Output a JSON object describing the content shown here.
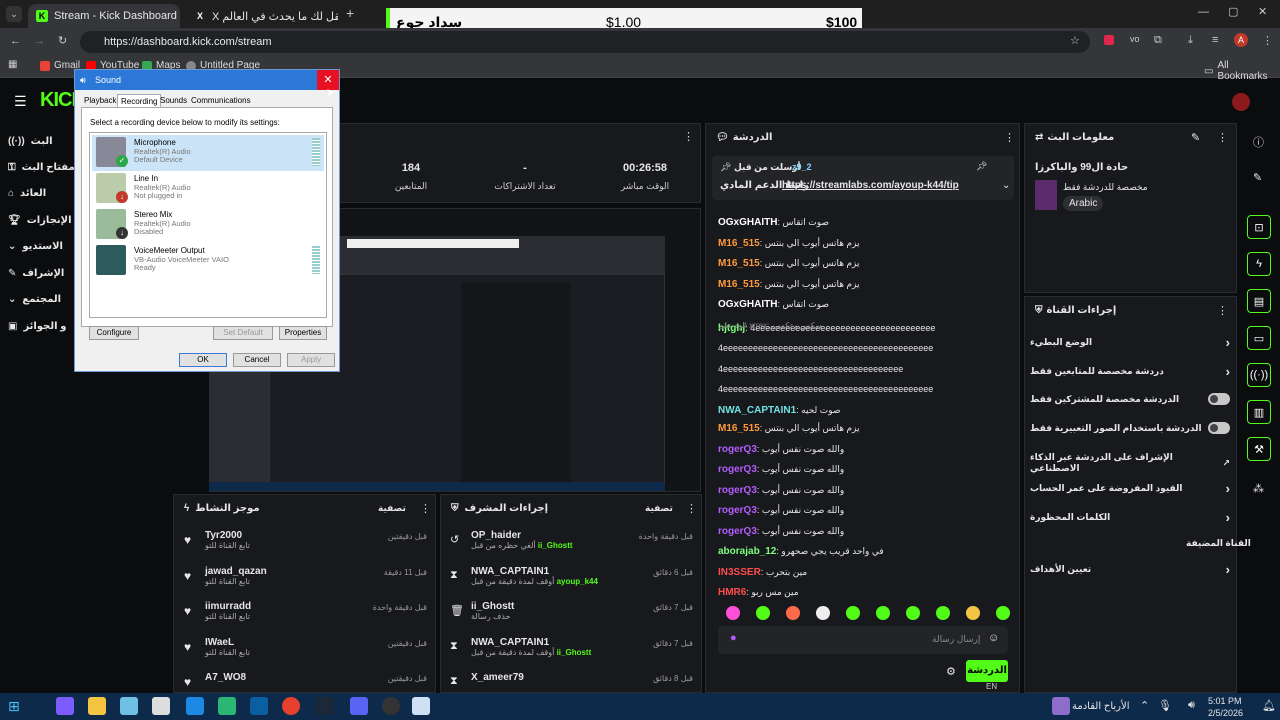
{
  "browser": {
    "tabs": [
      {
        "label": "Stream - Kick Dashboard"
      },
      {
        "label": "X يتقل لك ما يحدث في العالم / X"
      }
    ],
    "url": "https://dashboard.kick.com/stream",
    "bookmarks": [
      {
        "label": "Gmail"
      },
      {
        "label": "YouTube"
      },
      {
        "label": "Maps"
      },
      {
        "label": "Untitled Page"
      }
    ],
    "all_bookmarks": "All Bookmarks"
  },
  "donation_bar": {
    "title": "سداد جوع",
    "current": "$1.00",
    "goal": "$100"
  },
  "leftnav": {
    "items": [
      {
        "label": "البث"
      },
      {
        "label": "مفتاح البث"
      },
      {
        "label": "العائد"
      },
      {
        "label": "الإنجازات"
      },
      {
        "label": "الاستديو"
      },
      {
        "label": "الإشراف"
      },
      {
        "label": "المجتمع"
      },
      {
        "label": "و الجوائز"
      }
    ]
  },
  "stats": [
    {
      "value": "00:26:58",
      "label": "الوقت مباشر"
    },
    {
      "value": "-",
      "label": "تعداد الاشتراكات"
    },
    {
      "value": "184",
      "label": "المتابعين"
    }
  ],
  "chat": {
    "title": "الدردشة",
    "pinned_user": "z9_2",
    "pinned_by": "أرسلت من قبل",
    "pinned_text": "رابط الدعم المادي",
    "pinned_link": "https://streamlabs.com/ayoup-k44/tip",
    "messages": [
      {
        "user": "OGxGHAITH",
        "text": "صوت اتقاس",
        "color": "#ffffff"
      },
      {
        "user": "M16_515",
        "text": "يزم هاتس أيوب الي بنتس",
        "color": "#ff9a3c"
      },
      {
        "user": "M16_515",
        "text": "يزم هاتس أيوب الي بنتس",
        "color": "#ff9a3c"
      },
      {
        "user": "M16_515",
        "text": "يزم هاتس أيوب الي بنتس",
        "color": "#ff9a3c"
      },
      {
        "user": "OGxGHAITH",
        "text": "صوت اتقاس",
        "color": "#ffffff"
      },
      {
        "user": "hjtghj",
        "text": "4eeeeeeeeeeeeeeeeeeeeeeeeeeeeeeeeeeee",
        "color": "#7cff7c"
      },
      {
        "user": "",
        "text": "4eeeeeeeeeeeeeeeeeeeeeeeeeeeeeeeeeeeeeeeeee",
        "color": "#ffffff"
      },
      {
        "user": "",
        "text": "4eeeeeeeeeeeeeeeeeeeeeeeeeeeeeeeeeeee",
        "color": "#ffffff"
      },
      {
        "user": "",
        "text": "4eeeeeeeeeeeeeeeeeeeeeeeeeeeeeeeeeeeeeeeeee",
        "color": "#ffffff"
      },
      {
        "user": "NWA_CAPTAIN1",
        "text": "صوت لحيه",
        "color": "#6fe3e3"
      },
      {
        "user": "M16_515",
        "text": "يزم هاتس أيوب الي بنتس",
        "color": "#ff9a3c"
      },
      {
        "user": "rogerQ3",
        "text": "والله صوت نفس أيوب",
        "color": "#b45cff"
      },
      {
        "user": "rogerQ3",
        "text": "والله صوت نفس أيوب",
        "color": "#b45cff"
      },
      {
        "user": "rogerQ3",
        "text": "والله صوت نفس أيوب",
        "color": "#b45cff"
      },
      {
        "user": "rogerQ3",
        "text": "والله صوت نفس أيوب",
        "color": "#b45cff"
      },
      {
        "user": "rogerQ3",
        "text": "والله صوت نفس أيوب",
        "color": "#b45cff"
      },
      {
        "user": "aborajab_12",
        "text": "في واحد قريب يجي صحهرو",
        "color": "#7cff7c"
      },
      {
        "user": "IN3SSER",
        "text": "مين بتحرب",
        "color": "#ff4d4d"
      },
      {
        "user": "HMR6",
        "text": "مين مس ربو",
        "color": "#ff4d4d"
      }
    ],
    "reply_hint": "الرد على xrrex: سكس وعكسي",
    "input_placeholder": "إرسال رسالة",
    "send_label": "الدردشة"
  },
  "stream_info": {
    "title": "معلومات البث",
    "stream_title": "حادة ال99 والباكرزا",
    "category": "مخصصة للدردشة فقط",
    "language": "Arabic"
  },
  "channel_actions": {
    "title": "إجراءات القناة",
    "items": [
      {
        "label": "الوضع البطيء",
        "type": "chevron"
      },
      {
        "label": "دردشة مخصصة للمتابعين فقط",
        "type": "chevron"
      },
      {
        "label": "الدردشة مخصصة للمشتركين فقط",
        "type": "toggle"
      },
      {
        "label": "الدردشة باستخدام الصور التعبيرية فقط",
        "type": "toggle"
      },
      {
        "label": "الإشراف على الدردشة عبر الذكاء الاصطناعي",
        "type": "link"
      },
      {
        "label": "القيود المفروضة على عمر الحساب",
        "type": "chevron"
      },
      {
        "label": "الكلمات المحظورة",
        "type": "chevron"
      }
    ],
    "section": "القناة المضيفة",
    "goals": "تعيين الأهداف"
  },
  "activity": {
    "title": "موجز النشاط",
    "filter": "تصفية",
    "items": [
      {
        "name": "Tyr2000",
        "sub": "تابع القناة للتو",
        "time": "قبل دقيقتين"
      },
      {
        "name": "jawad_qazan",
        "sub": "تابع القناة للتو",
        "time": "قبل 11 دقيقة"
      },
      {
        "name": "iimurradd",
        "sub": "تابع القناة للتو",
        "time": "قبل دقيقة واحدة"
      },
      {
        "name": "IWaeL",
        "sub": "تابع القناة للتو",
        "time": "قبل دقيقتين"
      },
      {
        "name": "A7_WO8",
        "sub": "",
        "time": "قبل دقيقتين"
      }
    ]
  },
  "modactions": {
    "title": "إجراءات المشرف",
    "filter": "تصفية",
    "items": [
      {
        "name": "OP_haider",
        "sub": "ألغي حظره من قبل",
        "by": "ii_Ghostt",
        "time": "قبل دقيقة واحدة"
      },
      {
        "name": "NWA_CAPTAIN1",
        "sub": "أوقف لمدة دقيقة من قبل",
        "by": "ayoup_k44",
        "time": "قبل 6 دقائق"
      },
      {
        "name": "ii_Ghostt",
        "sub": "حذف رسالة",
        "by": "",
        "time": "قبل 7 دقائق"
      },
      {
        "name": "NWA_CAPTAIN1",
        "sub": "أوقف لمدة دقيقة من قبل",
        "by": "ii_Ghostt",
        "time": "قبل 7 دقائق"
      },
      {
        "name": "X_ameer79",
        "sub": "",
        "by": "",
        "time": "قبل 8 دقائق"
      }
    ]
  },
  "sound_dialog": {
    "title": "Sound",
    "tabs": [
      "Playback",
      "Recording",
      "Sounds",
      "Communications"
    ],
    "instruction": "Select a recording device below to modify its settings:",
    "devices": [
      {
        "name": "Microphone",
        "driver": "Realtek(R) Audio",
        "status": "Default Device"
      },
      {
        "name": "Line In",
        "driver": "Realtek(R) Audio",
        "status": "Not plugged in"
      },
      {
        "name": "Stereo Mix",
        "driver": "Realtek(R) Audio",
        "status": "Disabled"
      },
      {
        "name": "VoiceMeeter Output",
        "driver": "VB-Audio VoiceMeeter VAIO",
        "status": "Ready"
      }
    ],
    "configure": "Configure",
    "set_default": "Set Default",
    "properties": "Properties",
    "ok": "OK",
    "cancel": "Cancel",
    "apply": "Apply"
  },
  "taskbar": {
    "weather": "الأرباح القادمة",
    "lang": "EN",
    "time": "5:01 PM",
    "date": "2/5/2026"
  },
  "colors": {
    "brand": "#53fc18",
    "panel": "#18191d"
  }
}
